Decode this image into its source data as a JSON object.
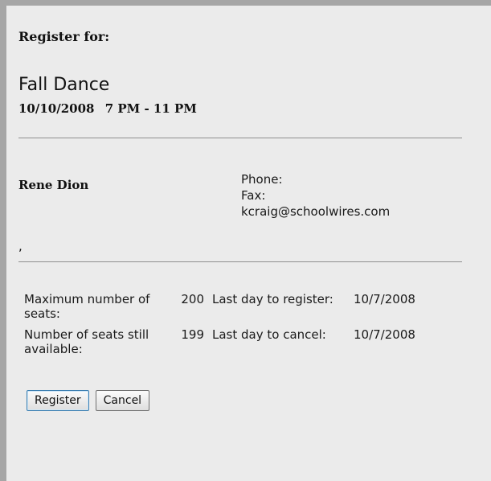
{
  "register_label": "Register for:",
  "event": {
    "title": "Fall Dance",
    "date": "10/10/2008",
    "time": "7 PM - 11 PM"
  },
  "contact": {
    "name": "Rene Dion",
    "phone_label": "Phone:",
    "fax_label": "Fax:",
    "email": "kcraig@schoolwires.com",
    "address": ","
  },
  "seats": {
    "max_label": "Maximum number of seats:",
    "max_value": "200",
    "available_label": "Number of seats still available:",
    "available_value": "199",
    "last_register_label": "Last day to register:",
    "last_register_date": "10/7/2008",
    "last_cancel_label": "Last day to cancel:",
    "last_cancel_date": "10/7/2008"
  },
  "buttons": {
    "register": "Register",
    "cancel": "Cancel"
  }
}
